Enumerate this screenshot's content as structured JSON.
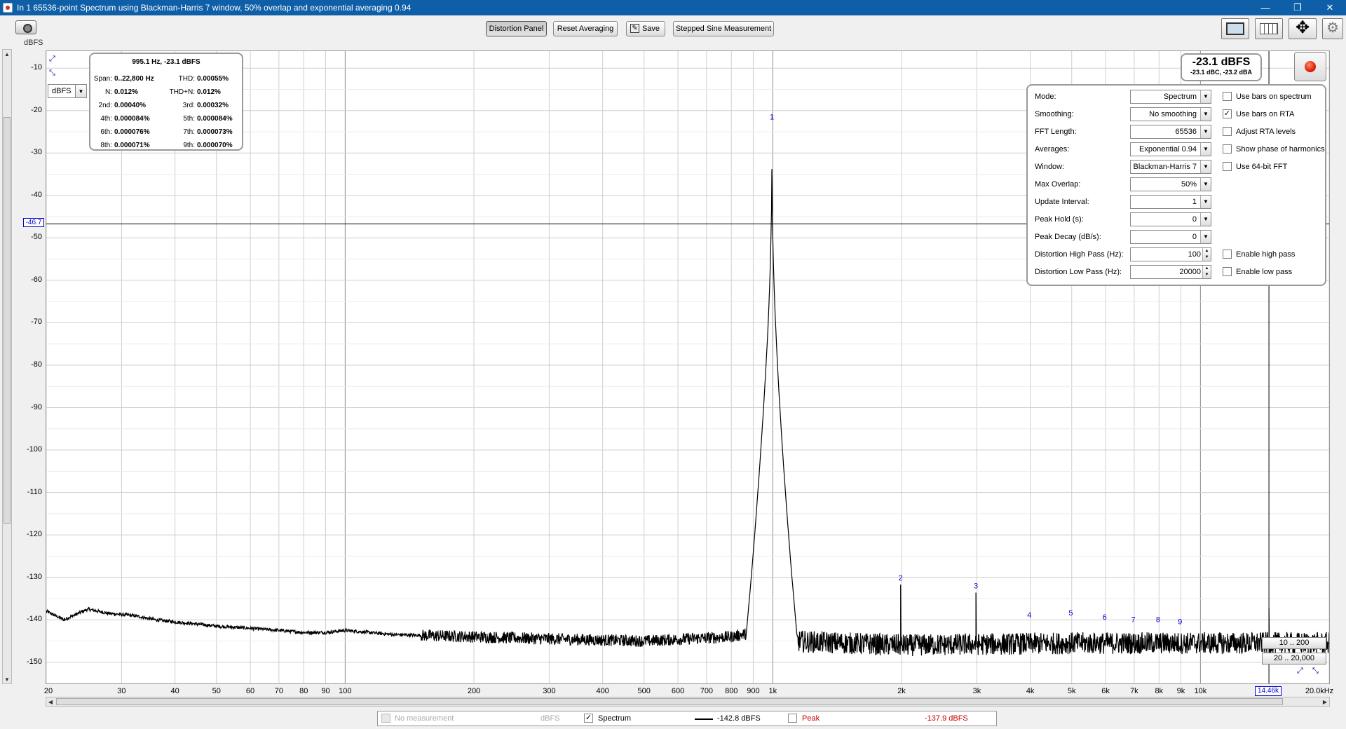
{
  "window": {
    "title": "In 1 65536-point Spectrum using Blackman-Harris 7 window, 50% overlap and exponential averaging 0.94",
    "minimize": "—",
    "restore": "❐",
    "close": "✕"
  },
  "toolbar": {
    "distortion_panel": "Distortion Panel",
    "reset_averaging": "Reset Averaging",
    "save": "Save",
    "stepped_sine": "Stepped Sine Measurement",
    "unit_label": "dBFS"
  },
  "distortion": {
    "header": "995.1 Hz, -23.1 dBFS",
    "rows": [
      {
        "l1": "Span:",
        "v1": "0..22,800 Hz",
        "l2": "THD:",
        "v2": "0.00055%"
      },
      {
        "l1": "N:",
        "v1": "0.012%",
        "l2": "THD+N:",
        "v2": "0.012%"
      },
      {
        "l1": "2nd:",
        "v1": "0.00040%",
        "l2": "3rd:",
        "v2": "0.00032%"
      },
      {
        "l1": "4th:",
        "v1": "0.000084%",
        "l2": "5th:",
        "v2": "0.000084%"
      },
      {
        "l1": "6th:",
        "v1": "0.000076%",
        "l2": "7th:",
        "v2": "0.000073%"
      },
      {
        "l1": "8th:",
        "v1": "0.000071%",
        "l2": "9th:",
        "v2": "0.000070%"
      }
    ]
  },
  "unit_select": "dBFS",
  "level": {
    "main": "-23.1 dBFS",
    "sub": "-23.1 dBC, -23.2 dBA"
  },
  "settings": {
    "rows": [
      {
        "label": "Mode:",
        "value": "Spectrum",
        "kind": "combo",
        "check": "Use bars on spectrum",
        "checked": false
      },
      {
        "label": "Smoothing:",
        "value": "No  smoothing",
        "kind": "combo",
        "check": "Use bars on RTA",
        "checked": true
      },
      {
        "label": "FFT Length:",
        "value": "65536",
        "kind": "combo",
        "check": "Adjust RTA levels",
        "checked": false
      },
      {
        "label": "Averages:",
        "value": "Exponential 0.94",
        "kind": "combo",
        "check": "Show phase of harmonics",
        "checked": false
      },
      {
        "label": "Window:",
        "value": "Blackman-Harris 7",
        "kind": "combo",
        "check": "Use 64-bit FFT",
        "checked": false
      },
      {
        "label": "Max Overlap:",
        "value": "50%",
        "kind": "combo",
        "check": "",
        "checked": false
      },
      {
        "label": "Update Interval:",
        "value": "1",
        "kind": "combo",
        "check": "",
        "checked": false
      },
      {
        "label": "Peak Hold (s):",
        "value": "0",
        "kind": "combo",
        "check": "",
        "checked": false
      },
      {
        "label": "Peak Decay (dB/s):",
        "value": "0",
        "kind": "combo",
        "check": "",
        "checked": false
      },
      {
        "label": "Distortion High Pass (Hz):",
        "value": "100",
        "kind": "spin",
        "check": "Enable high pass",
        "checked": false
      },
      {
        "label": "Distortion Low Pass (Hz):",
        "value": "20000",
        "kind": "spin",
        "check": "Enable low pass",
        "checked": false
      }
    ]
  },
  "ranges": {
    "r1": "10 .. 200",
    "r2": "20 .. 20,000"
  },
  "cursor": {
    "y_label": "-46.7",
    "x_label": "14.46k"
  },
  "legend": {
    "no_meas": "No measurement",
    "no_meas_unit": "dBFS",
    "spectrum": "Spectrum",
    "spectrum_checked": true,
    "spectrum_value": "-142.8 dBFS",
    "peak": "Peak",
    "peak_value": "-137.9 dBFS"
  },
  "chart_data": {
    "type": "line",
    "title": "",
    "xlabel": "Hz",
    "ylabel": "dBFS",
    "xscale": "log",
    "xlim": [
      20,
      20000
    ],
    "ylim": [
      -155,
      -6
    ],
    "yticks": [
      -10,
      -20,
      -30,
      -40,
      -50,
      -60,
      -70,
      -80,
      -90,
      -100,
      -110,
      -120,
      -130,
      -140,
      -150
    ],
    "xticks": [
      {
        "v": 20,
        "t": "20"
      },
      {
        "v": 30,
        "t": "30"
      },
      {
        "v": 40,
        "t": "40"
      },
      {
        "v": 50,
        "t": "50"
      },
      {
        "v": 60,
        "t": "60"
      },
      {
        "v": 70,
        "t": "70"
      },
      {
        "v": 80,
        "t": "80"
      },
      {
        "v": 90,
        "t": "90"
      },
      {
        "v": 100,
        "t": "100"
      },
      {
        "v": 200,
        "t": "200"
      },
      {
        "v": 300,
        "t": "300"
      },
      {
        "v": 400,
        "t": "400"
      },
      {
        "v": 500,
        "t": "500"
      },
      {
        "v": 600,
        "t": "600"
      },
      {
        "v": 700,
        "t": "700"
      },
      {
        "v": 800,
        "t": "800"
      },
      {
        "v": 900,
        "t": "900"
      },
      {
        "v": 1000,
        "t": "1k"
      },
      {
        "v": 2000,
        "t": "2k"
      },
      {
        "v": 3000,
        "t": "3k"
      },
      {
        "v": 4000,
        "t": "4k"
      },
      {
        "v": 5000,
        "t": "5k"
      },
      {
        "v": 6000,
        "t": "6k"
      },
      {
        "v": 7000,
        "t": "7k"
      },
      {
        "v": 8000,
        "t": "8k"
      },
      {
        "v": 9000,
        "t": "9k"
      },
      {
        "v": 10000,
        "t": "10k"
      },
      {
        "v": 20000,
        "t": "20.0kHz"
      }
    ],
    "cursor_y": -46.7,
    "cursor_x": 14460,
    "series": [
      {
        "name": "Spectrum",
        "color": "#000000",
        "baseline": [
          [
            20,
            -138
          ],
          [
            22,
            -140
          ],
          [
            25,
            -137.5
          ],
          [
            28,
            -138.5
          ],
          [
            32,
            -139
          ],
          [
            36,
            -140
          ],
          [
            40,
            -140.5
          ],
          [
            45,
            -141
          ],
          [
            50,
            -141.5
          ],
          [
            60,
            -142
          ],
          [
            70,
            -142.5
          ],
          [
            80,
            -143
          ],
          [
            90,
            -143
          ],
          [
            100,
            -142.5
          ],
          [
            130,
            -143.5
          ],
          [
            200,
            -144
          ],
          [
            300,
            -144.5
          ],
          [
            500,
            -145
          ],
          [
            800,
            -144
          ],
          [
            900,
            -143
          ],
          [
            960,
            -140
          ],
          [
            1000,
            -141
          ],
          [
            1040,
            -143
          ],
          [
            1100,
            -145
          ],
          [
            2000,
            -146
          ],
          [
            5000,
            -145.5
          ],
          [
            10000,
            -145.5
          ],
          [
            20000,
            -145.5
          ]
        ],
        "peaks": [
          {
            "f": 995.1,
            "db": -23.1
          },
          {
            "f": 1990,
            "db": -131.7
          },
          {
            "f": 2985,
            "db": -133.6
          },
          {
            "f": 14460,
            "db": -137.2
          }
        ]
      }
    ],
    "harmonic_labels": [
      {
        "n": "1",
        "f": 995.1,
        "db": -23.1
      },
      {
        "n": "2",
        "f": 1990,
        "db": -131.7
      },
      {
        "n": "3",
        "f": 2985,
        "db": -133.6
      },
      {
        "n": "4",
        "f": 3980,
        "db": -140.5
      },
      {
        "n": "5",
        "f": 4975,
        "db": -140
      },
      {
        "n": "6",
        "f": 5970,
        "db": -141
      },
      {
        "n": "7",
        "f": 6965,
        "db": -141.5
      },
      {
        "n": "8",
        "f": 7960,
        "db": -141.5
      },
      {
        "n": "9",
        "f": 8955,
        "db": -142
      }
    ]
  }
}
